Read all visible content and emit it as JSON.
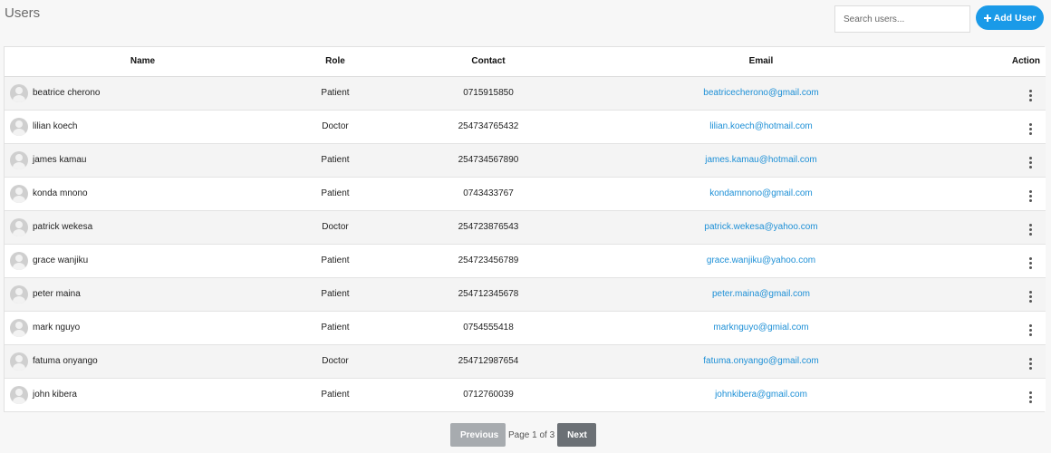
{
  "header": {
    "title": "Users",
    "search_placeholder": "Search users...",
    "add_label": "Add User"
  },
  "table": {
    "columns": [
      "Name",
      "Role",
      "Contact",
      "Email",
      "Action"
    ],
    "rows": [
      {
        "name": "beatrice cherono",
        "role": "Patient",
        "contact": "0715915850",
        "email": "beatricecherono@gmail.com"
      },
      {
        "name": "lilian koech",
        "role": "Doctor",
        "contact": "254734765432",
        "email": "lilian.koech@hotmail.com"
      },
      {
        "name": "james kamau",
        "role": "Patient",
        "contact": "254734567890",
        "email": "james.kamau@hotmail.com"
      },
      {
        "name": "konda mnono",
        "role": "Patient",
        "contact": "0743433767",
        "email": "kondamnono@gmail.com"
      },
      {
        "name": "patrick wekesa",
        "role": "Doctor",
        "contact": "254723876543",
        "email": "patrick.wekesa@yahoo.com"
      },
      {
        "name": "grace wanjiku",
        "role": "Patient",
        "contact": "254723456789",
        "email": "grace.wanjiku@yahoo.com"
      },
      {
        "name": "peter maina",
        "role": "Patient",
        "contact": "254712345678",
        "email": "peter.maina@gmail.com"
      },
      {
        "name": "mark nguyo",
        "role": "Patient",
        "contact": "0754555418",
        "email": "marknguyo@gmial.com"
      },
      {
        "name": "fatuma onyango",
        "role": "Doctor",
        "contact": "254712987654",
        "email": "fatuma.onyango@gmail.com"
      },
      {
        "name": "john kibera",
        "role": "Patient",
        "contact": "0712760039",
        "email": "johnkibera@gmail.com"
      }
    ]
  },
  "pagination": {
    "previous_label": "Previous",
    "page_info": "Page 1 of 3",
    "next_label": "Next"
  },
  "icons": {
    "add": "plus-icon",
    "avatar": "user-avatar-icon",
    "action": "kebab-menu-icon"
  },
  "colors": {
    "accent": "#1a9ae8",
    "email_link": "#1c8fd6",
    "prev_disabled": "#a7abaf",
    "next": "#6b7075"
  }
}
